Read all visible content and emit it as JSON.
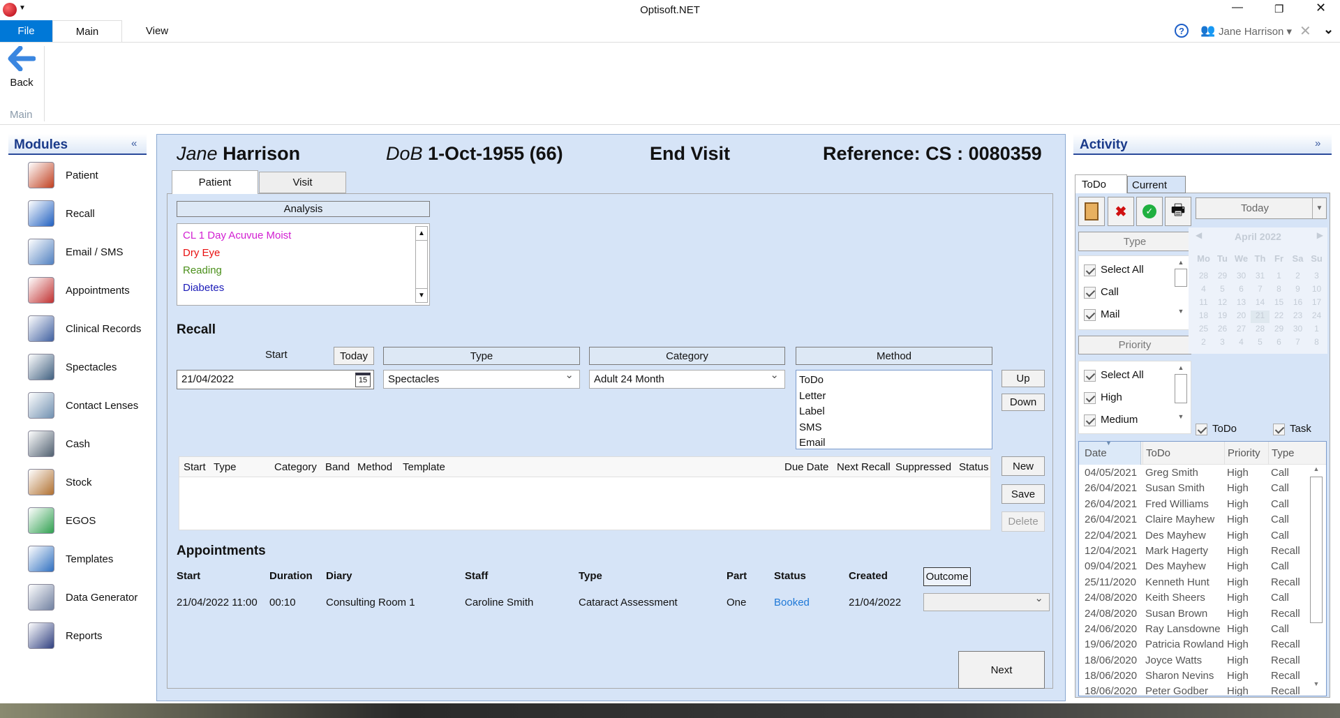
{
  "window": {
    "title": "Optisoft.NET",
    "user": "Jane Harrison ▾"
  },
  "ribbon": {
    "tabs": [
      "File",
      "Main",
      "View"
    ],
    "back_label": "Back",
    "group_label": "Main"
  },
  "modules": {
    "title": "Modules",
    "collapse": "«",
    "items": [
      "Patient",
      "Recall",
      "Email / SMS",
      "Appointments",
      "Clinical Records",
      "Spectacles",
      "Contact Lenses",
      "Cash",
      "Stock",
      "EGOS",
      "Templates",
      "Data Generator",
      "Reports"
    ]
  },
  "patient": {
    "first_name": "Jane",
    "last_name": "Harrison",
    "dob_label": "DoB",
    "dob": "1-Oct-1955 (66)",
    "visit_action": "End Visit",
    "reference": "Reference: CS : 0080359"
  },
  "tabs": [
    "Patient",
    "Visit"
  ],
  "analysis": {
    "header": "Analysis",
    "items": [
      {
        "text": "CL 1 Day Acuvue Moist",
        "color": "#d21fd2"
      },
      {
        "text": "Dry Eye",
        "color": "#e81010"
      },
      {
        "text": "Reading",
        "color": "#4a8f1a"
      },
      {
        "text": "Diabetes",
        "color": "#1a1ab8"
      }
    ]
  },
  "recall": {
    "title": "Recall",
    "start_label": "Start",
    "today_button": "Today",
    "type_header": "Type",
    "category_header": "Category",
    "method_header": "Method",
    "start_value": "21/04/2022",
    "calendar_day": "15",
    "type_value": "Spectacles",
    "category_value": "Adult 24 Month",
    "methods": [
      "ToDo",
      "Letter",
      "Label",
      "SMS",
      "Email"
    ],
    "up": "Up",
    "down": "Down",
    "new": "New",
    "save": "Save",
    "delete": "Delete",
    "columns": [
      "Start",
      "Type",
      "Category",
      "Band",
      "Method",
      "Template",
      "Due Date",
      "Next Recall",
      "Suppressed",
      "Status"
    ]
  },
  "appointments": {
    "title": "Appointments",
    "columns": [
      "Start",
      "Duration",
      "Diary",
      "Staff",
      "Type",
      "Part",
      "Status",
      "Created"
    ],
    "outcome_button": "Outcome",
    "row": [
      "21/04/2022 11:00",
      "00:10",
      "Consulting Room 1",
      "Caroline Smith",
      "Cataract Assessment",
      "One",
      "Booked",
      "21/04/2022"
    ],
    "status_color": "#1e78d7",
    "outcome_value": ""
  },
  "next_button": "Next",
  "activity": {
    "title": "Activity",
    "expand": "»",
    "tabs": [
      "ToDo",
      "Current"
    ],
    "today_dropdown": "Today",
    "type_header": "Type",
    "type_items": [
      "Select All",
      "Call",
      "Mail"
    ],
    "priority_header": "Priority",
    "priority_items": [
      "Select All",
      "High",
      "Medium"
    ],
    "todo_check": "ToDo",
    "task_check": "Task",
    "calendar": {
      "month": "April 2022",
      "days": [
        "Mo",
        "Tu",
        "We",
        "Th",
        "Fr",
        "Sa",
        "Su"
      ],
      "weeks": [
        [
          "28",
          "29",
          "30",
          "31",
          "1",
          "2",
          "3"
        ],
        [
          "4",
          "5",
          "6",
          "7",
          "8",
          "9",
          "10"
        ],
        [
          "11",
          "12",
          "13",
          "14",
          "15",
          "16",
          "17"
        ],
        [
          "18",
          "19",
          "20",
          "21",
          "22",
          "23",
          "24"
        ],
        [
          "25",
          "26",
          "27",
          "28",
          "29",
          "30",
          "1"
        ],
        [
          "2",
          "3",
          "4",
          "5",
          "6",
          "7",
          "8"
        ]
      ],
      "selected": "21"
    },
    "columns": [
      "Date",
      "ToDo",
      "Priority",
      "Type"
    ],
    "rows": [
      [
        "04/05/2021",
        "Greg Smith",
        "High",
        "Call"
      ],
      [
        "26/04/2021",
        "Susan Smith",
        "High",
        "Call"
      ],
      [
        "26/04/2021",
        "Fred Williams",
        "High",
        "Call"
      ],
      [
        "26/04/2021",
        "Claire Mayhew",
        "High",
        "Call"
      ],
      [
        "22/04/2021",
        "Des Mayhew",
        "High",
        "Call"
      ],
      [
        "12/04/2021",
        "Mark Hagerty",
        "High",
        "Recall"
      ],
      [
        "09/04/2021",
        "Des Mayhew",
        "High",
        "Call"
      ],
      [
        "25/11/2020",
        "Kenneth Hunt",
        "High",
        "Recall"
      ],
      [
        "24/08/2020",
        "Keith Sheers",
        "High",
        "Call"
      ],
      [
        "24/08/2020",
        "Susan Brown",
        "High",
        "Recall"
      ],
      [
        "24/06/2020",
        "Ray Lansdowne",
        "High",
        "Call"
      ],
      [
        "19/06/2020",
        "Patricia Rowland",
        "High",
        "Recall"
      ],
      [
        "18/06/2020",
        "Joyce Watts",
        "High",
        "Recall"
      ],
      [
        "18/06/2020",
        "Sharon Nevins",
        "High",
        "Recall"
      ],
      [
        "18/06/2020",
        "Peter Godber",
        "High",
        "Recall"
      ]
    ]
  },
  "colors": {
    "accent": "#0078d7",
    "panel": "#d6e4f7",
    "header_text": "#1a3a8a"
  }
}
